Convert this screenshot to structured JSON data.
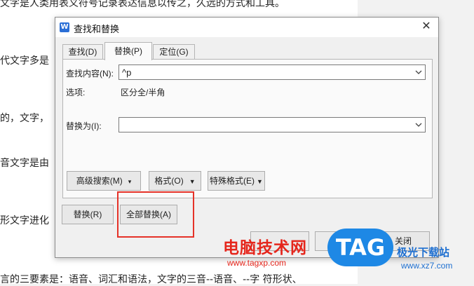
{
  "document": {
    "lines": [
      "文字是人类用表义符号记录表达信息以传之，久远的方式和工具。",
      "代文字多是",
      "的，文字，",
      "音文字是由",
      "形文字进化",
      "言的三要素是：语音、词汇和语法，文字的三音--语音、--字  符形状、"
    ]
  },
  "dialog": {
    "title": "查找和替换",
    "tabs": [
      {
        "label": "查找(D)"
      },
      {
        "label": "替换(P)"
      },
      {
        "label": "定位(G)"
      }
    ],
    "find_label": "查找内容(N):",
    "find_value": "^p",
    "options_label": "选项:",
    "options_value": "区分全/半角",
    "replace_label": "替换为(I):",
    "replace_value": "",
    "buttons": {
      "advanced": "高级搜索(M)",
      "format": "格式(O)",
      "special": "特殊格式(E)",
      "replace": "替换(R)",
      "replace_all": "全部替换(A)",
      "close": "关闭"
    }
  },
  "watermark": {
    "site_name": "电脑技术网",
    "site_url": "www.tagxp.com",
    "logo_text": "TAG",
    "right_name": "极光下载站",
    "right_url": "www.xz7.com"
  }
}
